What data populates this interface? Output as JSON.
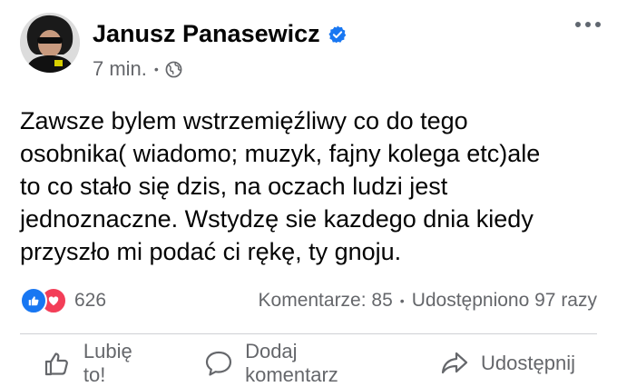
{
  "post": {
    "author": "Janusz Panasewicz",
    "time": "7 min.",
    "meta_separator": "•",
    "text": "Zawsze bylem wstrzemięźliwy co do tego\nosobnika( wiadomo; muzyk, fajny kolega etc)ale\nto co stało się dzis, na oczach ludzi jest\njednoznaczne. Wstydzę sie kazdego dnia kiedy\nprzyszło mi podać ci rękę, ty gnoju."
  },
  "stats": {
    "reaction_count": "626",
    "comments": "Komentarze: 85",
    "separator": "•",
    "shares": "Udostępniono 97 razy"
  },
  "actions": {
    "like": "Lubię to!",
    "comment": "Dodaj komentarz",
    "share": "Udostępnij"
  },
  "icons": {
    "verified": "verified-badge-icon",
    "privacy": "globe-icon",
    "more": "more-options-icon",
    "reaction_like": "like-reaction-icon",
    "reaction_love": "love-reaction-icon"
  },
  "colors": {
    "accent": "#1877f2",
    "love": "#f33e58",
    "secondary_text": "#65676b"
  }
}
